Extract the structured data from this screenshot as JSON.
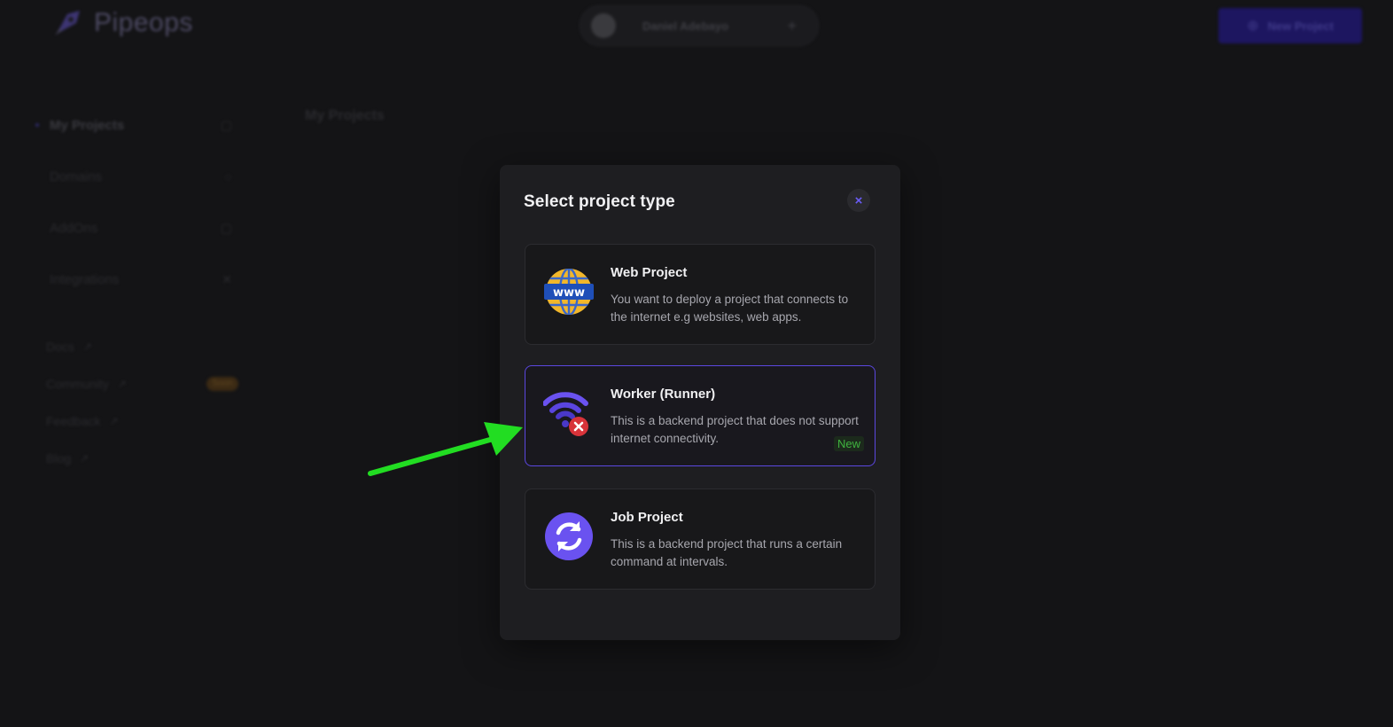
{
  "app": {
    "brand": "Pipeops",
    "user_name": "Daniel Adebayo",
    "new_project_label": "New Project"
  },
  "sidebar": {
    "items": [
      {
        "label": "My Projects",
        "active": true
      },
      {
        "label": "Domains"
      },
      {
        "label": "AddOns"
      },
      {
        "label": "Integrations"
      }
    ],
    "links": [
      {
        "label": "Docs"
      },
      {
        "label": "Community"
      },
      {
        "label": "Feedback"
      },
      {
        "label": "Blog"
      }
    ],
    "soon_badge": "Soon"
  },
  "main": {
    "title": "My Projects"
  },
  "modal": {
    "title": "Select project type",
    "close_symbol": "×",
    "options": [
      {
        "title": "Web Project",
        "description": "You want to deploy a project that connects to the internet e.g websites, web apps.",
        "icon": "globe-www-icon"
      },
      {
        "title": "Worker (Runner)",
        "description": "This is a backend project that does not support internet connectivity.",
        "icon": "wifi-off-icon",
        "badge": "New",
        "selected": true
      },
      {
        "title": "Job Project",
        "description": "This is a backend project that runs a certain command at intervals.",
        "icon": "refresh-cycle-icon"
      }
    ]
  },
  "colors": {
    "accent": "#5b47e0",
    "badge_green": "#3fb33f",
    "annotation_arrow": "#22dd22"
  }
}
